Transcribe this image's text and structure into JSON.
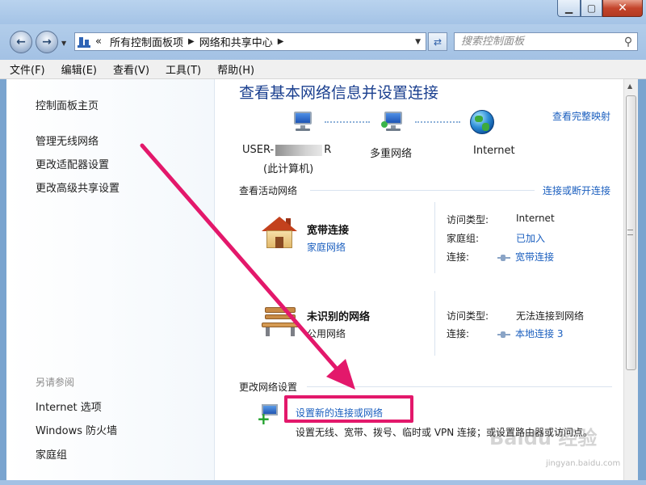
{
  "window": {
    "caption_buttons": {
      "minimize_icon": "minimize-icon",
      "maximize_icon": "maximize-icon",
      "close_icon": "close-icon"
    }
  },
  "navigation": {
    "back_icon": "back-arrow-icon",
    "forward_icon": "forward-arrow-icon",
    "breadcrumb": [
      "«",
      "所有控制面板项",
      "网络和共享中心"
    ],
    "refresh_icon": "refresh-icon",
    "search_placeholder": "搜索控制面板",
    "search_icon": "search-icon"
  },
  "menu": [
    "文件(F)",
    "编辑(E)",
    "查看(V)",
    "工具(T)",
    "帮助(H)"
  ],
  "sidebar": {
    "top_links": [
      "控制面板主页",
      "管理无线网络",
      "更改适配器设置",
      "更改高级共享设置"
    ],
    "see_also_title": "另请参阅",
    "see_also_links": [
      "Internet 选项",
      "Windows 防火墙",
      "家庭组"
    ]
  },
  "main": {
    "title": "查看基本网络信息并设置连接",
    "full_map_link": "查看完整映射",
    "map": {
      "computer_prefix": "USER-",
      "computer_suffix": "R",
      "computer_sub": "(此计算机)",
      "middle": "多重网络",
      "end": "Internet"
    },
    "active_section": {
      "title": "查看活动网络",
      "action_link": "连接或断开连接",
      "networks": [
        {
          "name": "宽带连接",
          "type": "家庭网络",
          "icon": "house-icon",
          "rows": [
            {
              "key": "访问类型:",
              "value": "Internet",
              "link": false
            },
            {
              "key": "家庭组:",
              "value": "已加入",
              "link": true
            },
            {
              "key": "连接:",
              "value": "宽带连接",
              "link": true
            }
          ]
        },
        {
          "name": "未识别的网络",
          "type": "公用网络",
          "icon": "bench-icon",
          "rows": [
            {
              "key": "访问类型:",
              "value": "无法连接到网络",
              "link": false
            },
            {
              "key": "连接:",
              "value": "本地连接 3",
              "link": true
            }
          ]
        }
      ]
    },
    "change_section": {
      "title": "更改网络设置",
      "setup_link": "设置新的连接或网络",
      "setup_desc": "设置无线、宽带、拨号、临时或 VPN 连接；或设置路由器或访问点。"
    }
  },
  "watermark": {
    "brand": "Baidu 经验",
    "url": "jingyan.baidu.com"
  },
  "colors": {
    "link": "#1b5fbf",
    "title": "#1a3f8f",
    "highlight": "#e3186b"
  }
}
